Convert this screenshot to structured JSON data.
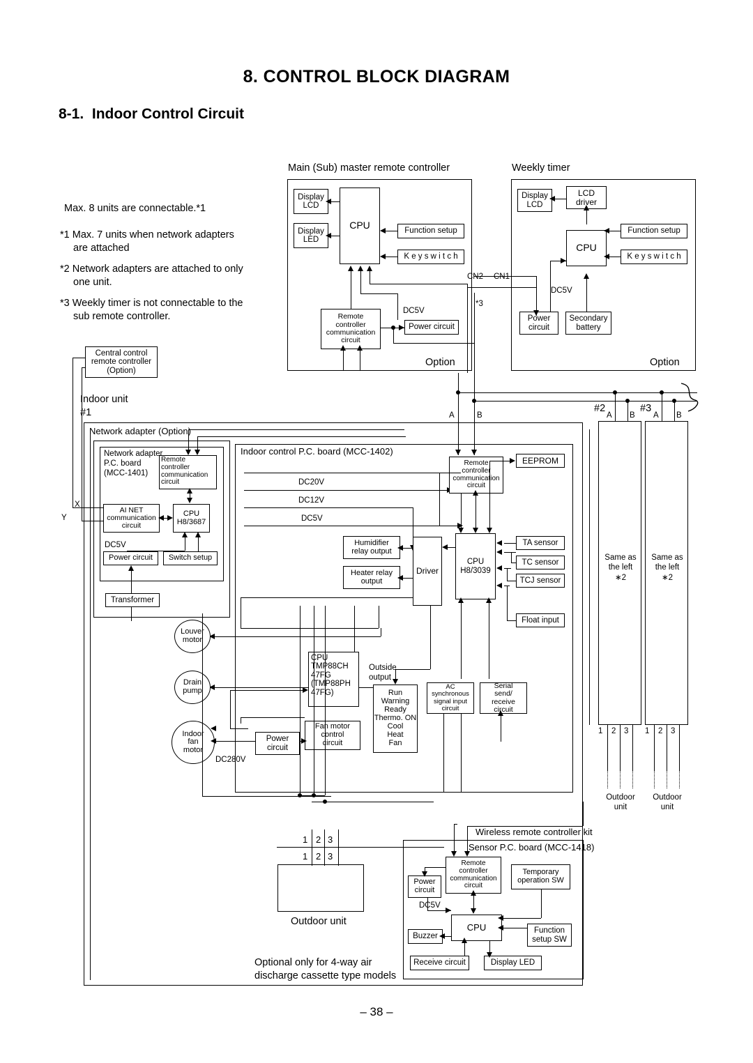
{
  "page": {
    "title": "8. CONTROL BLOCK DIAGRAM",
    "section": "8-1.  Indoor Control Circuit",
    "page_number": "– 38 –"
  },
  "notes": {
    "max_units": "Max. 8 units are connectable.*1",
    "n1": "*1 Max. 7 units when network adapters",
    "n1b": "are attached",
    "n2": "*2 Network adapters are attached to only",
    "n2b": "one unit.",
    "n3": "*3 Weekly timer is not connectable to the",
    "n3b": "sub remote controller."
  },
  "central": {
    "l1": "Central control",
    "l2": "remote controller",
    "l3": "(Option)"
  },
  "main_rc": {
    "caption": "Main (Sub) master remote controller",
    "display_lcd": "Display\nLCD",
    "display_led": "Display\nLED",
    "cpu": "CPU",
    "function_setup": "Function setup",
    "key_switch": "K e y   s w i t c h",
    "rc_comm": "Remote\ncontroller\ncommunication\ncircuit",
    "dc5v": "DC5V",
    "power_circuit": "Power circuit",
    "option": "Option",
    "cn2": "CN2",
    "cn1": "CN1",
    "star3": "*3"
  },
  "weekly_timer": {
    "caption": "Weekly timer",
    "display_lcd": "Display\nLCD",
    "lcd_driver": "LCD\ndriver",
    "cpu": "CPU",
    "function_setup": "Function setup",
    "key_switch": "K e y   s w i t c h",
    "dc5v": "DC5V",
    "power_circuit": "Power\ncircuit",
    "secondary_battery": "Secondary\nbattery",
    "option": "Option"
  },
  "indoor": {
    "unit_label": "Indoor unit",
    "unit_number": "#1",
    "net_adapter_option": "Network adapter (Option)",
    "na_board": "Network adapter\nP.C. board\n(MCC-1401)",
    "na_rc_comm": "Remote\ncontroller\ncommunication\ncircuit",
    "ai_net": "AI NET\ncommunication\ncircuit",
    "na_cpu": "CPU\nH8/3687",
    "na_dc5v": "DC5V",
    "na_power": "Power circuit",
    "switch_setup": "Switch setup",
    "transformer": "Transformer",
    "term_x": "X",
    "term_y": "Y",
    "pcb_caption": "Indoor control P.C. board (MCC-1402)",
    "dc20v": "DC20V",
    "dc12v": "DC12V",
    "dc5v": "DC5V",
    "rc_comm": "Remote\ncontroller\ncommunication\ncircuit",
    "eeprom": "EEPROM",
    "cpu": "CPU\nH8/3039",
    "humidifier": "Humidifier\nrelay output",
    "heater": "Heater relay\noutput",
    "driver": "Driver",
    "ta_sensor": "TA sensor",
    "tc_sensor": "TC sensor",
    "tcj_sensor": "TCJ sensor",
    "float_input": "Float input",
    "louver_motor": "Louver\nmotor",
    "drain_pump": "Drain\npump",
    "indoor_fan_motor": "Indoor\nfan\nmotor",
    "dc280v": "DC280V",
    "cpu_tmp": "CPU\nTMP88CH\n47FG\n(TMP88PH\n47FG)",
    "outside_output_label": "Outside\noutput",
    "outside_output": "Run\nWarning\nReady\nThermo. ON\nCool\nHeat\nFan",
    "ac_sync": "AC\nsynchronous\nsignal input\ncircuit",
    "serial": "Serial\nsend/\nreceive\ncircuit",
    "fan_motor_ctrl": "Fan motor\ncontrol\ncircuit",
    "power_circuit": "Power\ncircuit",
    "term_a": "A",
    "term_b": "B"
  },
  "other_units": [
    {
      "number": "#2",
      "a": "A",
      "b": "B",
      "body": "Same as\nthe left\n∗2",
      "t1": "1",
      "t2": "2",
      "t3": "3",
      "outdoor": "Outdoor\nunit"
    },
    {
      "number": "#3",
      "a": "A",
      "b": "B",
      "body": "Same as\nthe left\n∗2",
      "t1": "1",
      "t2": "2",
      "t3": "3",
      "outdoor": "Outdoor\nunit"
    }
  ],
  "outdoor_unit": {
    "label": "Outdoor unit",
    "t1": "1",
    "t2": "2",
    "t3": "3",
    "b1": "1",
    "b2": "2",
    "b3": "3",
    "footnote": "Optional only for 4-way air\ndischarge cassette type models"
  },
  "wireless_kit": {
    "caption": "Wireless remote controller kit",
    "sensor_board": "Sensor P.C. board (MCC-1418)",
    "rc_comm": "Remote\ncontroller\ncommunication\ncircuit",
    "temp_sw": "Temporary\noperation SW",
    "power_circuit": "Power\ncircuit",
    "dc5v": "DC5V",
    "cpu": "CPU",
    "buzzer": "Buzzer",
    "function_sw": "Function\nsetup SW",
    "receive_circuit": "Receive circuit",
    "display_led": "Display LED"
  }
}
